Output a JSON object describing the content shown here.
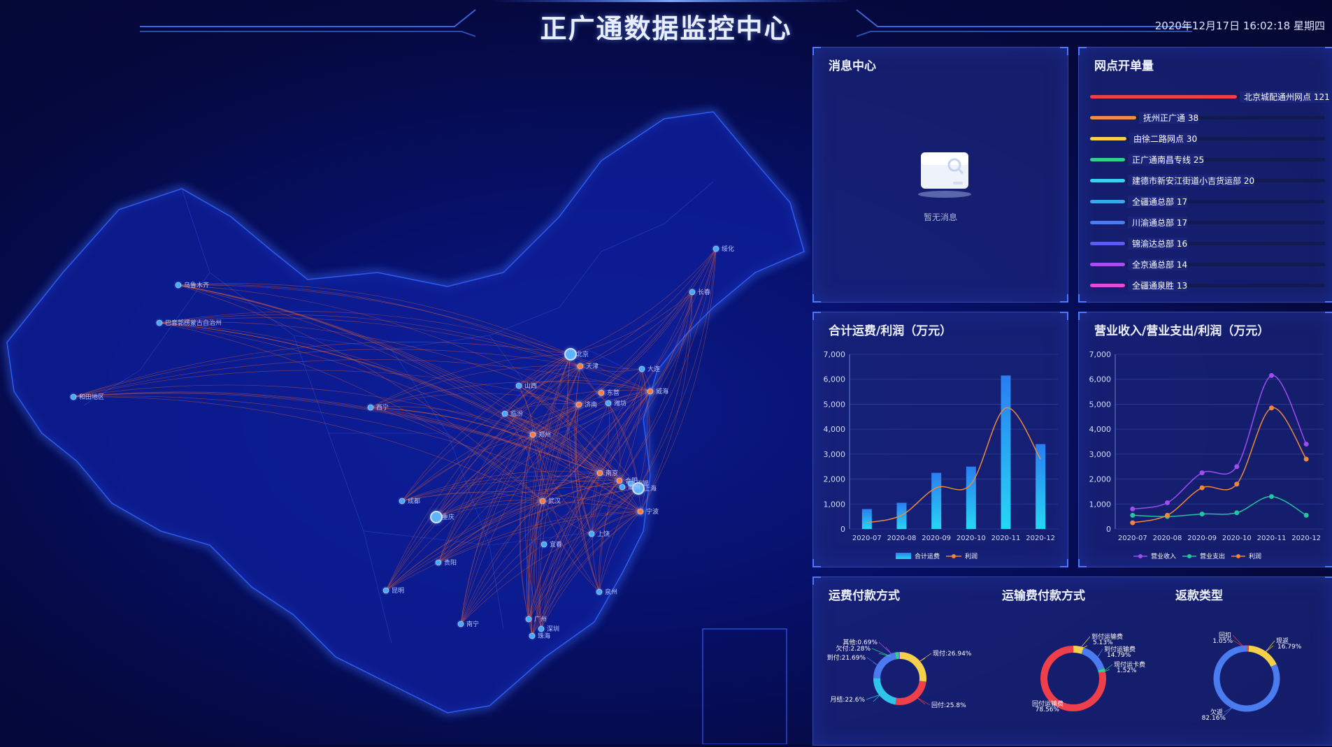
{
  "header": {
    "title": "正广通数据监控中心",
    "clock": "2020年12月17日 16:02:18 星期四"
  },
  "map": {
    "cities": [
      "乌鲁木齐",
      "巴音郭楞蒙古自治州",
      "和田地区",
      "西宁",
      "北京",
      "天津",
      "大连",
      "长春",
      "绥化",
      "山西",
      "东营",
      "威海",
      "潍坊",
      "济南",
      "临汾",
      "郑州",
      "南京",
      "合肥",
      "无锡",
      "上海",
      "武汉",
      "成都",
      "重庆",
      "湖州",
      "上饶",
      "宜春",
      "贵阳",
      "昆明",
      "泉州",
      "南宁",
      "广州",
      "深圳",
      "珠海",
      "宁波"
    ]
  },
  "messages": {
    "title": "消息中心",
    "empty": "暂无消息"
  },
  "ranking": {
    "title": "网点开单量",
    "items": [
      {
        "label": "北京城配通州网点 121",
        "value": 121,
        "color": "#ef3f4b"
      },
      {
        "label": "抚州正广通 38",
        "value": 38,
        "color": "#f28a4a"
      },
      {
        "label": "由徐二路网点 30",
        "value": 30,
        "color": "#f7cf4e"
      },
      {
        "label": "正广通南昌专线 25",
        "value": 25,
        "color": "#2fd18c"
      },
      {
        "label": "建德市新安江街道小吉货运部 20",
        "value": 20,
        "color": "#3ad2f0"
      },
      {
        "label": "全疆通总部 17",
        "value": 17,
        "color": "#3aa6ee"
      },
      {
        "label": "川渝通总部 17",
        "value": 17,
        "color": "#4a7cf0"
      },
      {
        "label": "锦渝达总部 16",
        "value": 16,
        "color": "#5a5df0"
      },
      {
        "label": "全京通总部 14",
        "value": 14,
        "color": "#a84ef0"
      },
      {
        "label": "全疆通泉胜 13",
        "value": 13,
        "color": "#e64ad8"
      }
    ]
  },
  "freight_chart": {
    "title": "合计运费/利润（万元）",
    "legend": [
      "合计运费",
      "利润"
    ]
  },
  "revenue_chart": {
    "title": "营业收入/营业支出/利润（万元）",
    "legend": [
      "营业收入",
      "营业支出",
      "利润"
    ]
  },
  "donuts": {
    "pay_title": "运费付款方式",
    "transport_title": "运输费付款方式",
    "rebate_title": "返款类型",
    "pay_labels": [
      "其他:0.69%",
      "欠付:2.28%",
      "到付:21.69%",
      "月结:22.6%",
      "回付:25.8%",
      "现付:26.94%"
    ],
    "transport_labels": [
      "到付运输费",
      "5.13%",
      "到付运输费",
      "14.79%",
      "现付运卡费",
      "1.52%",
      "回付运输费",
      "78.56%"
    ],
    "rebate_labels": [
      "回扣",
      "1.05%",
      "现返",
      "16.79%",
      "欠返",
      "82.16%"
    ]
  },
  "colors": {
    "blue_bar": "#2a8cf0",
    "profit": "#f0883a",
    "income": "#a04cf0",
    "expense": "#23c4a0"
  },
  "chart_data": [
    {
      "type": "bar",
      "title": "合计运费/利润（万元）",
      "categories": [
        "2020-07",
        "2020-08",
        "2020-09",
        "2020-10",
        "2020-11",
        "2020-12"
      ],
      "series": [
        {
          "name": "合计运费",
          "type": "bar",
          "values": [
            800,
            1050,
            2250,
            2500,
            6150,
            3400
          ]
        },
        {
          "name": "利润",
          "type": "line",
          "values": [
            250,
            550,
            1650,
            1800,
            4850,
            2800
          ]
        }
      ],
      "ylim": [
        0,
        7000
      ],
      "yticks": [
        0,
        1000,
        2000,
        3000,
        4000,
        5000,
        6000,
        7000
      ],
      "legend": "bottom"
    },
    {
      "type": "line",
      "title": "营业收入/营业支出/利润（万元）",
      "categories": [
        "2020-07",
        "2020-08",
        "2020-09",
        "2020-10",
        "2020-11",
        "2020-12"
      ],
      "series": [
        {
          "name": "营业收入",
          "values": [
            800,
            1050,
            2250,
            2500,
            6150,
            3400
          ]
        },
        {
          "name": "营业支出",
          "values": [
            550,
            500,
            600,
            650,
            1300,
            550
          ]
        },
        {
          "name": "利润",
          "values": [
            250,
            550,
            1650,
            1800,
            4850,
            2800
          ]
        }
      ],
      "ylim": [
        0,
        7000
      ],
      "yticks": [
        0,
        1000,
        2000,
        3000,
        4000,
        5000,
        6000,
        7000
      ],
      "legend": "bottom"
    },
    {
      "type": "pie",
      "title": "运费付款方式",
      "categories": [
        "现付",
        "回付",
        "月结",
        "到付",
        "欠付",
        "其他"
      ],
      "values": [
        26.94,
        25.8,
        22.6,
        21.69,
        2.28,
        0.69
      ]
    },
    {
      "type": "pie",
      "title": "运输费付款方式",
      "categories": [
        "到付运输费",
        "到付运输费",
        "现付运卡费",
        "回付运输费"
      ],
      "values": [
        5.13,
        14.79,
        1.52,
        78.56
      ]
    },
    {
      "type": "pie",
      "title": "返款类型",
      "categories": [
        "回扣",
        "现返",
        "欠返"
      ],
      "values": [
        1.05,
        16.79,
        82.16
      ]
    }
  ]
}
